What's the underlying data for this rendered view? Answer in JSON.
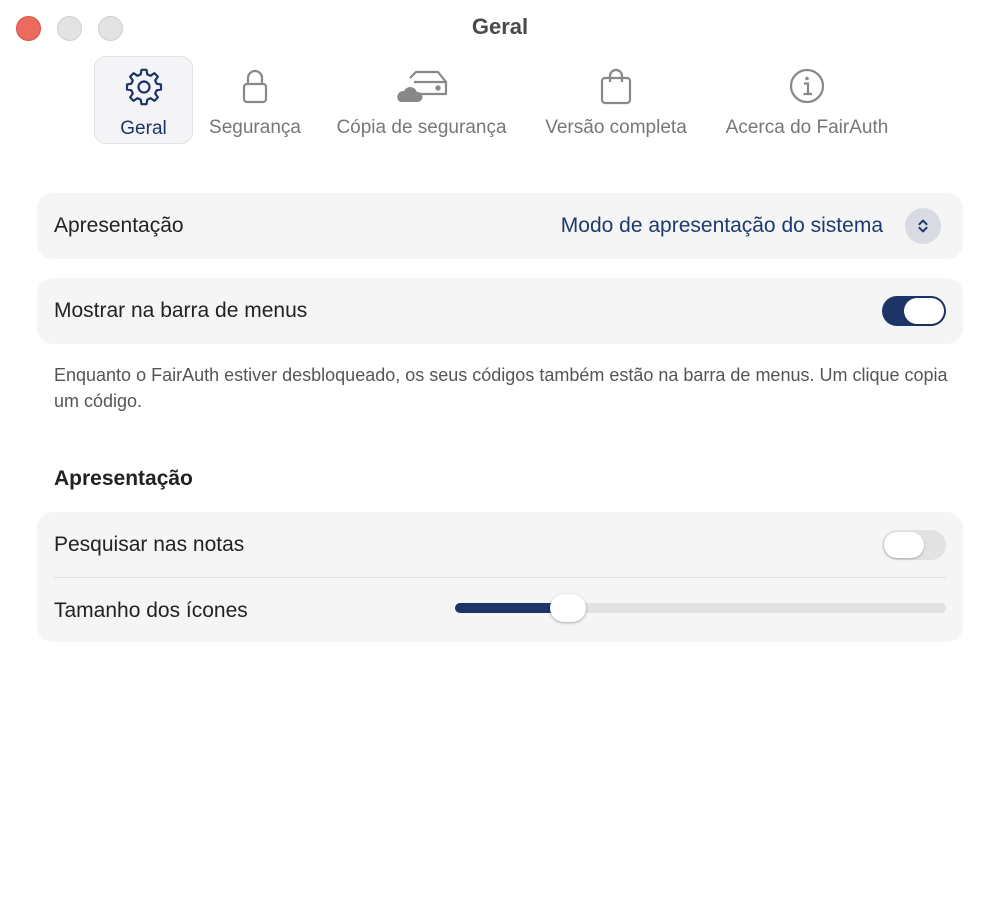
{
  "window": {
    "title": "Geral"
  },
  "toolbar": {
    "tabs": [
      {
        "label": "Geral",
        "icon": "gear-icon",
        "active": true
      },
      {
        "label": "Segurança",
        "icon": "lock-icon",
        "active": false
      },
      {
        "label": "Cópia de segurança",
        "icon": "cloud-drive-icon",
        "active": false
      },
      {
        "label": "Versão completa",
        "icon": "shopping-bag-icon",
        "active": false
      },
      {
        "label": "Acerca do FairAuth",
        "icon": "info-icon",
        "active": false
      }
    ]
  },
  "appearance": {
    "label": "Apresentação",
    "value": "Modo de apresentação do sistema"
  },
  "menubar": {
    "label": "Mostrar na barra de menus",
    "enabled": true,
    "help": "Enquanto o FairAuth estiver desbloqueado, os seus códigos também estão na barra de menus. Um clique copia um código."
  },
  "presentation_section": {
    "title": "Apresentação",
    "search_notes": {
      "label": "Pesquisar nas notas",
      "enabled": false
    },
    "icon_size": {
      "label": "Tamanho dos ícones",
      "value_fraction": 0.19
    }
  },
  "colors": {
    "accent": "#1d3566",
    "close_button": "#ec6a5e"
  }
}
